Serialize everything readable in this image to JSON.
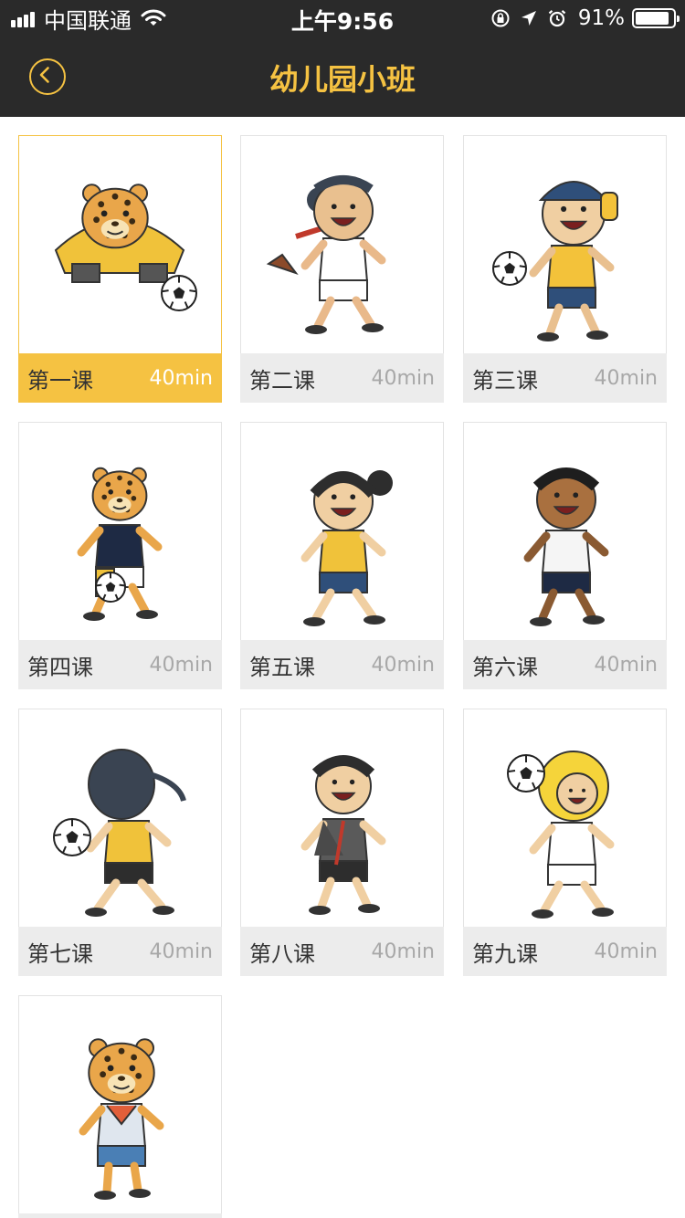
{
  "status_bar": {
    "carrier": "中国联通",
    "time": "上午9:56",
    "battery_percent": "91%",
    "battery_level": 0.91
  },
  "nav": {
    "title": "幼儿园小班",
    "back_icon": "chevron-left-circle-icon",
    "accent_color": "#f5c242"
  },
  "lessons": [
    {
      "name": "第一课",
      "duration": "40min",
      "selected": true,
      "character": "leopard-crouching"
    },
    {
      "name": "第二课",
      "duration": "40min",
      "selected": false,
      "character": "boy-running"
    },
    {
      "name": "第三课",
      "duration": "40min",
      "selected": false,
      "character": "boy-cap-ball"
    },
    {
      "name": "第四课",
      "duration": "40min",
      "selected": false,
      "character": "leopard-kicking"
    },
    {
      "name": "第五课",
      "duration": "40min",
      "selected": false,
      "character": "girl-bun"
    },
    {
      "name": "第六课",
      "duration": "40min",
      "selected": false,
      "character": "boy-dark"
    },
    {
      "name": "第七课",
      "duration": "40min",
      "selected": false,
      "character": "girl-ball"
    },
    {
      "name": "第八课",
      "duration": "40min",
      "selected": false,
      "character": "boy-jacket"
    },
    {
      "name": "第九课",
      "duration": "40min",
      "selected": false,
      "character": "blond-kid-ball"
    },
    {
      "name": "",
      "duration": "",
      "selected": false,
      "character": "leopard-standing"
    }
  ]
}
